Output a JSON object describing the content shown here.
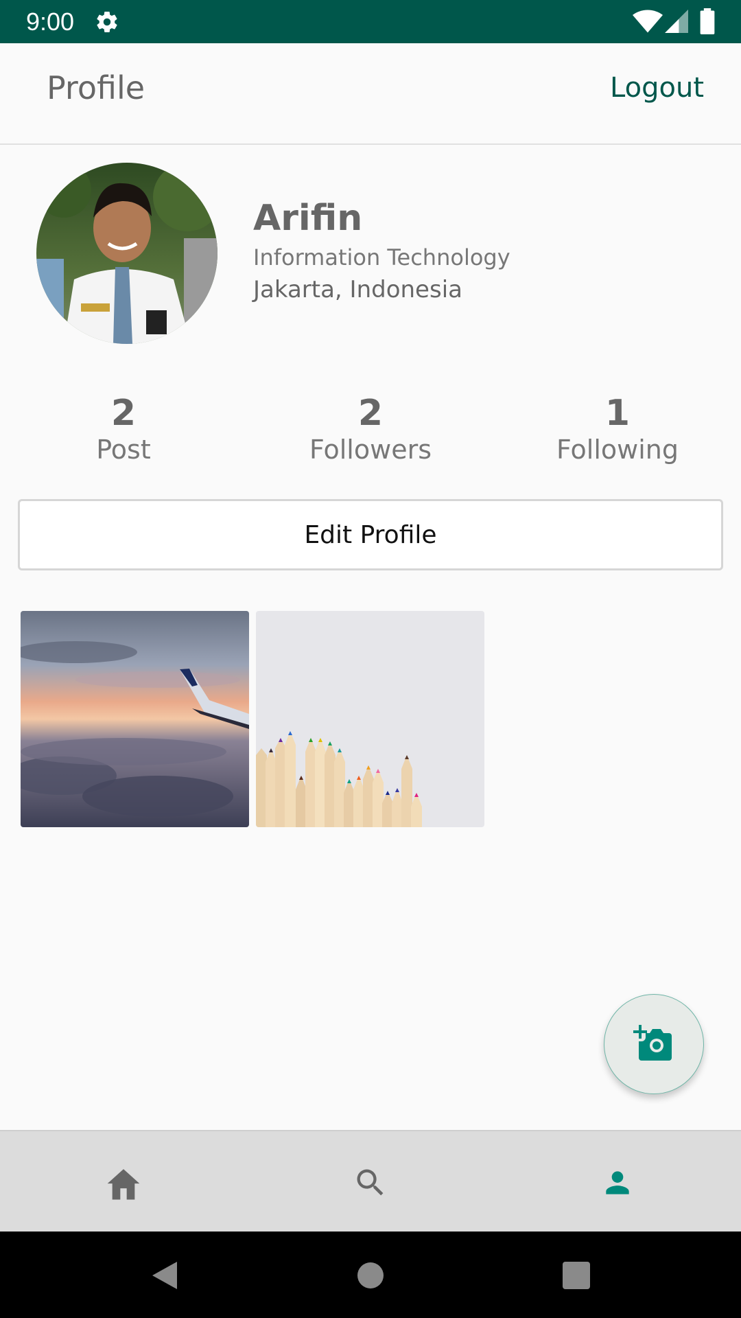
{
  "status_bar": {
    "time": "9:00",
    "icons": [
      "gear-icon",
      "wifi-icon",
      "signal-icon",
      "battery-icon"
    ]
  },
  "header": {
    "title": "Profile",
    "logout_label": "Logout"
  },
  "profile": {
    "name": "Arifin",
    "major": "Information Technology",
    "location": "Jakarta, Indonesia"
  },
  "stats": {
    "post": {
      "count": "2",
      "label": "Post"
    },
    "followers": {
      "count": "2",
      "label": "Followers"
    },
    "following": {
      "count": "1",
      "label": "Following"
    }
  },
  "edit_profile_label": "Edit Profile",
  "posts": [
    {
      "subject": "airplane wing above clouds at sunset"
    },
    {
      "subject": "colored pencils on white background"
    }
  ],
  "fab": {
    "icon": "add-photo-icon"
  },
  "bottom_nav": [
    {
      "icon": "home-icon",
      "active": false
    },
    {
      "icon": "search-icon",
      "active": false
    },
    {
      "icon": "person-icon",
      "active": true
    }
  ],
  "colors": {
    "primary_dark": "#00574b",
    "accent": "#00897b",
    "text": "#666666"
  }
}
